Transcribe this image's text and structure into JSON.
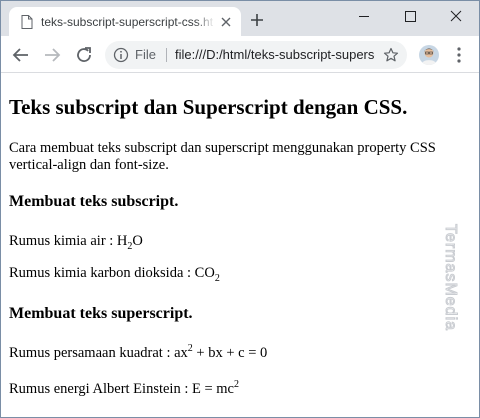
{
  "browser": {
    "tab_title": "teks-subscript-superscript-css.html",
    "address_scheme": "File",
    "address_url": "file:///D:/html/teks-subscript-superscript-css.html",
    "accent_color": "#1a73e8"
  },
  "page": {
    "title": "Teks subscript dan Superscript dengan CSS.",
    "intro": "Cara membuat teks subscript dan superscript menggunakan property CSS vertical-align dan font-size.",
    "subscript_heading": "Membuat teks subscript.",
    "water_formula": {
      "label": "Rumus kimia air : H",
      "sub": "2",
      "after": "O"
    },
    "co2_formula": {
      "label": "Rumus kimia karbon dioksida : CO",
      "sub": "2"
    },
    "superscript_heading": "Membuat teks superscript.",
    "quadratic_formula": {
      "label": "Rumus persamaan kuadrat : ax",
      "sup": "2",
      "after": " + bx + c = 0"
    },
    "einstein_formula": {
      "label": "Rumus energi Albert Einstein : E = mc",
      "sup": "2"
    }
  },
  "watermark": "TermasMedia"
}
